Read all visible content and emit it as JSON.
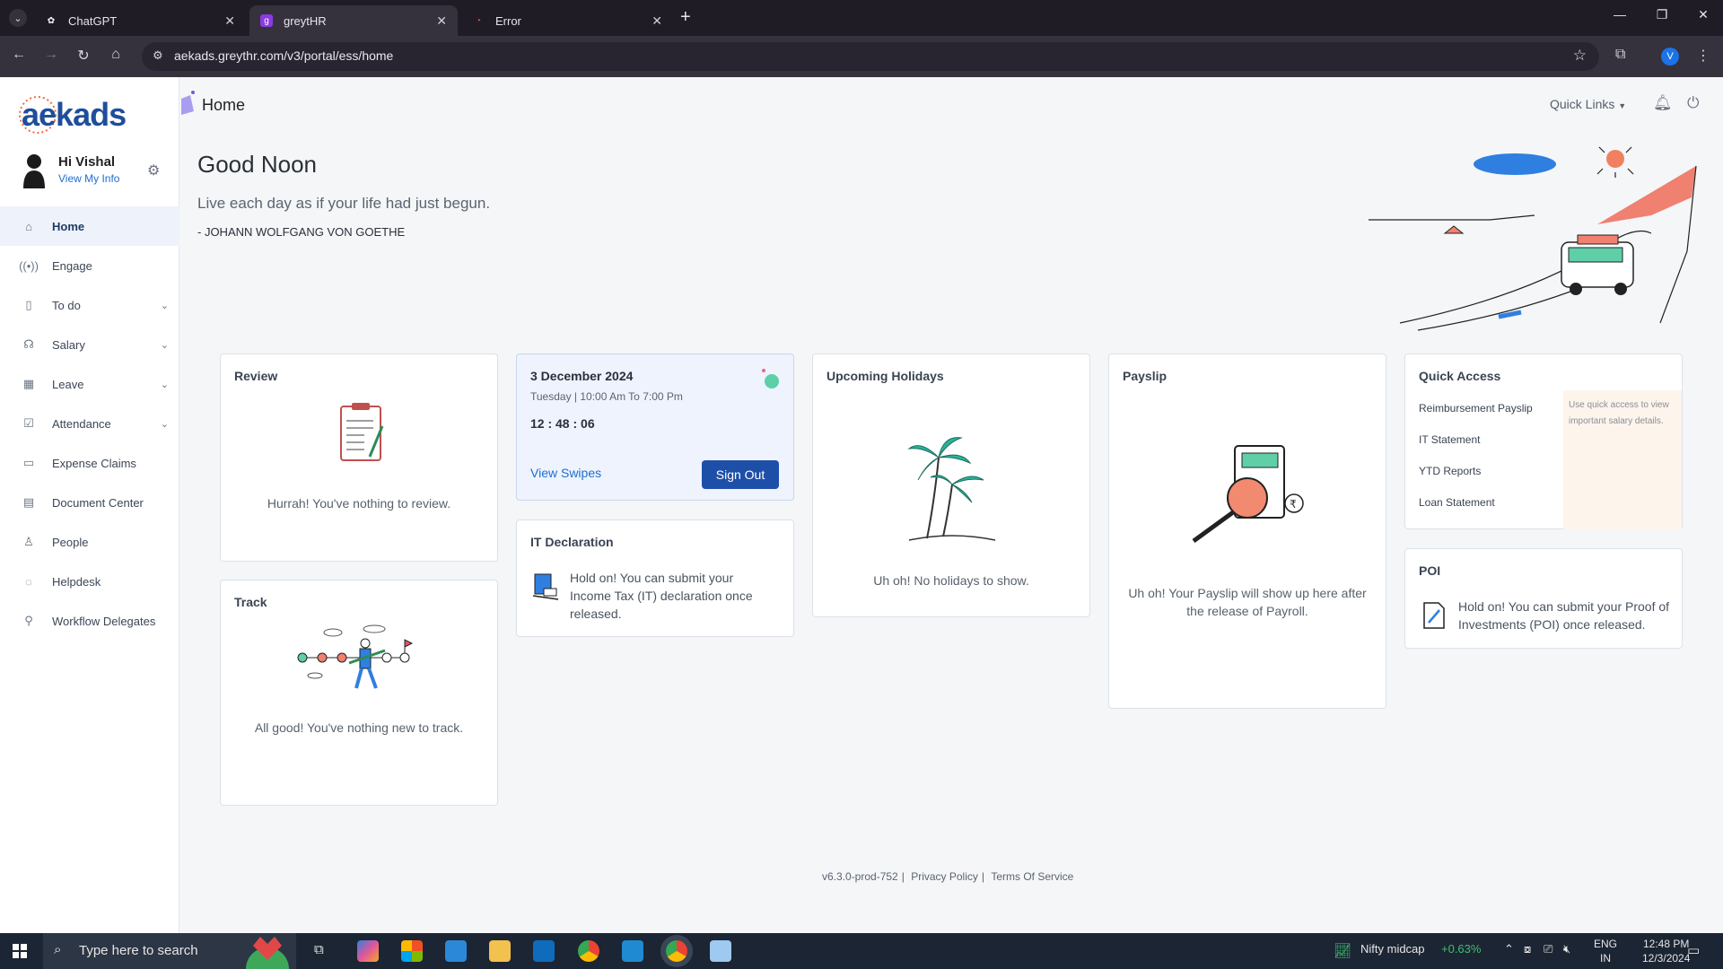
{
  "browser": {
    "tabs": [
      {
        "title": "ChatGPT",
        "active": false
      },
      {
        "title": "greytHR",
        "active": true
      },
      {
        "title": "Error",
        "active": false
      }
    ],
    "url": "aekads.greythr.com/v3/portal/ess/home",
    "profile_initial": "V"
  },
  "app": {
    "logo": "aekads",
    "page_title": "Home",
    "quick_links": "Quick Links",
    "user": {
      "greeting": "Hi Vishal",
      "view_info": "View My Info"
    },
    "nav": [
      {
        "label": "Home",
        "icon": "home-icon",
        "active": true,
        "has_submenu": false
      },
      {
        "label": "Engage",
        "icon": "broadcast-icon",
        "active": false,
        "has_submenu": false
      },
      {
        "label": "To do",
        "icon": "clipboard-icon",
        "active": false,
        "has_submenu": true
      },
      {
        "label": "Salary",
        "icon": "hand-money-icon",
        "active": false,
        "has_submenu": true
      },
      {
        "label": "Leave",
        "icon": "calendar-icon",
        "active": false,
        "has_submenu": true
      },
      {
        "label": "Attendance",
        "icon": "checklist-icon",
        "active": false,
        "has_submenu": true
      },
      {
        "label": "Expense Claims",
        "icon": "wallet-icon",
        "active": false,
        "has_submenu": false
      },
      {
        "label": "Document Center",
        "icon": "document-icon",
        "active": false,
        "has_submenu": false
      },
      {
        "label": "People",
        "icon": "people-icon",
        "active": false,
        "has_submenu": false
      },
      {
        "label": "Helpdesk",
        "icon": "helpdesk-icon",
        "active": false,
        "has_submenu": false
      },
      {
        "label": "Workflow Delegates",
        "icon": "workflow-icon",
        "active": false,
        "has_submenu": false
      }
    ]
  },
  "hero": {
    "greeting": "Good Noon",
    "quote": "Live each day as if your life had just begun.",
    "author": "- JOHANN WOLFGANG VON GOETHE"
  },
  "cards": {
    "review": {
      "title": "Review",
      "message": "Hurrah! You've nothing to review."
    },
    "track": {
      "title": "Track",
      "message": "All good! You've nothing new to track."
    },
    "attendance": {
      "date": "3 December 2024",
      "shift": "Tuesday | 10:00 Am To 7:00 Pm",
      "time": "12 : 48 : 06",
      "view_swipes": "View Swipes",
      "sign_out": "Sign Out"
    },
    "it_declaration": {
      "title": "IT Declaration",
      "message": "Hold on! You can submit your Income Tax (IT) declaration once released."
    },
    "holidays": {
      "title": "Upcoming Holidays",
      "message": "Uh oh! No holidays to show."
    },
    "payslip": {
      "title": "Payslip",
      "message": "Uh oh! Your Payslip will show up here after the release of Payroll."
    },
    "quick_access": {
      "title": "Quick Access",
      "links": [
        "Reimbursement Payslip",
        "IT Statement",
        "YTD Reports",
        "Loan Statement"
      ],
      "note": "Use quick access to view important salary details."
    },
    "poi": {
      "title": "POI",
      "message": "Hold on! You can submit your Proof of Investments (POI) once released."
    }
  },
  "footer": {
    "version": "v6.3.0-prod-752",
    "privacy": "Privacy Policy",
    "terms": "Terms Of Service"
  },
  "taskbar": {
    "search_placeholder": "Type here to search",
    "ticker_name": "Nifty midcap",
    "ticker_change": "+0.63%",
    "lang_line1": "ENG",
    "lang_line2": "IN",
    "time": "12:48 PM",
    "date": "12/3/2024"
  },
  "colors": {
    "accent": "#1e4fa8",
    "link": "#1d6fd1",
    "positive": "#3fbf6f",
    "status_dot": "#5ecfa7"
  }
}
